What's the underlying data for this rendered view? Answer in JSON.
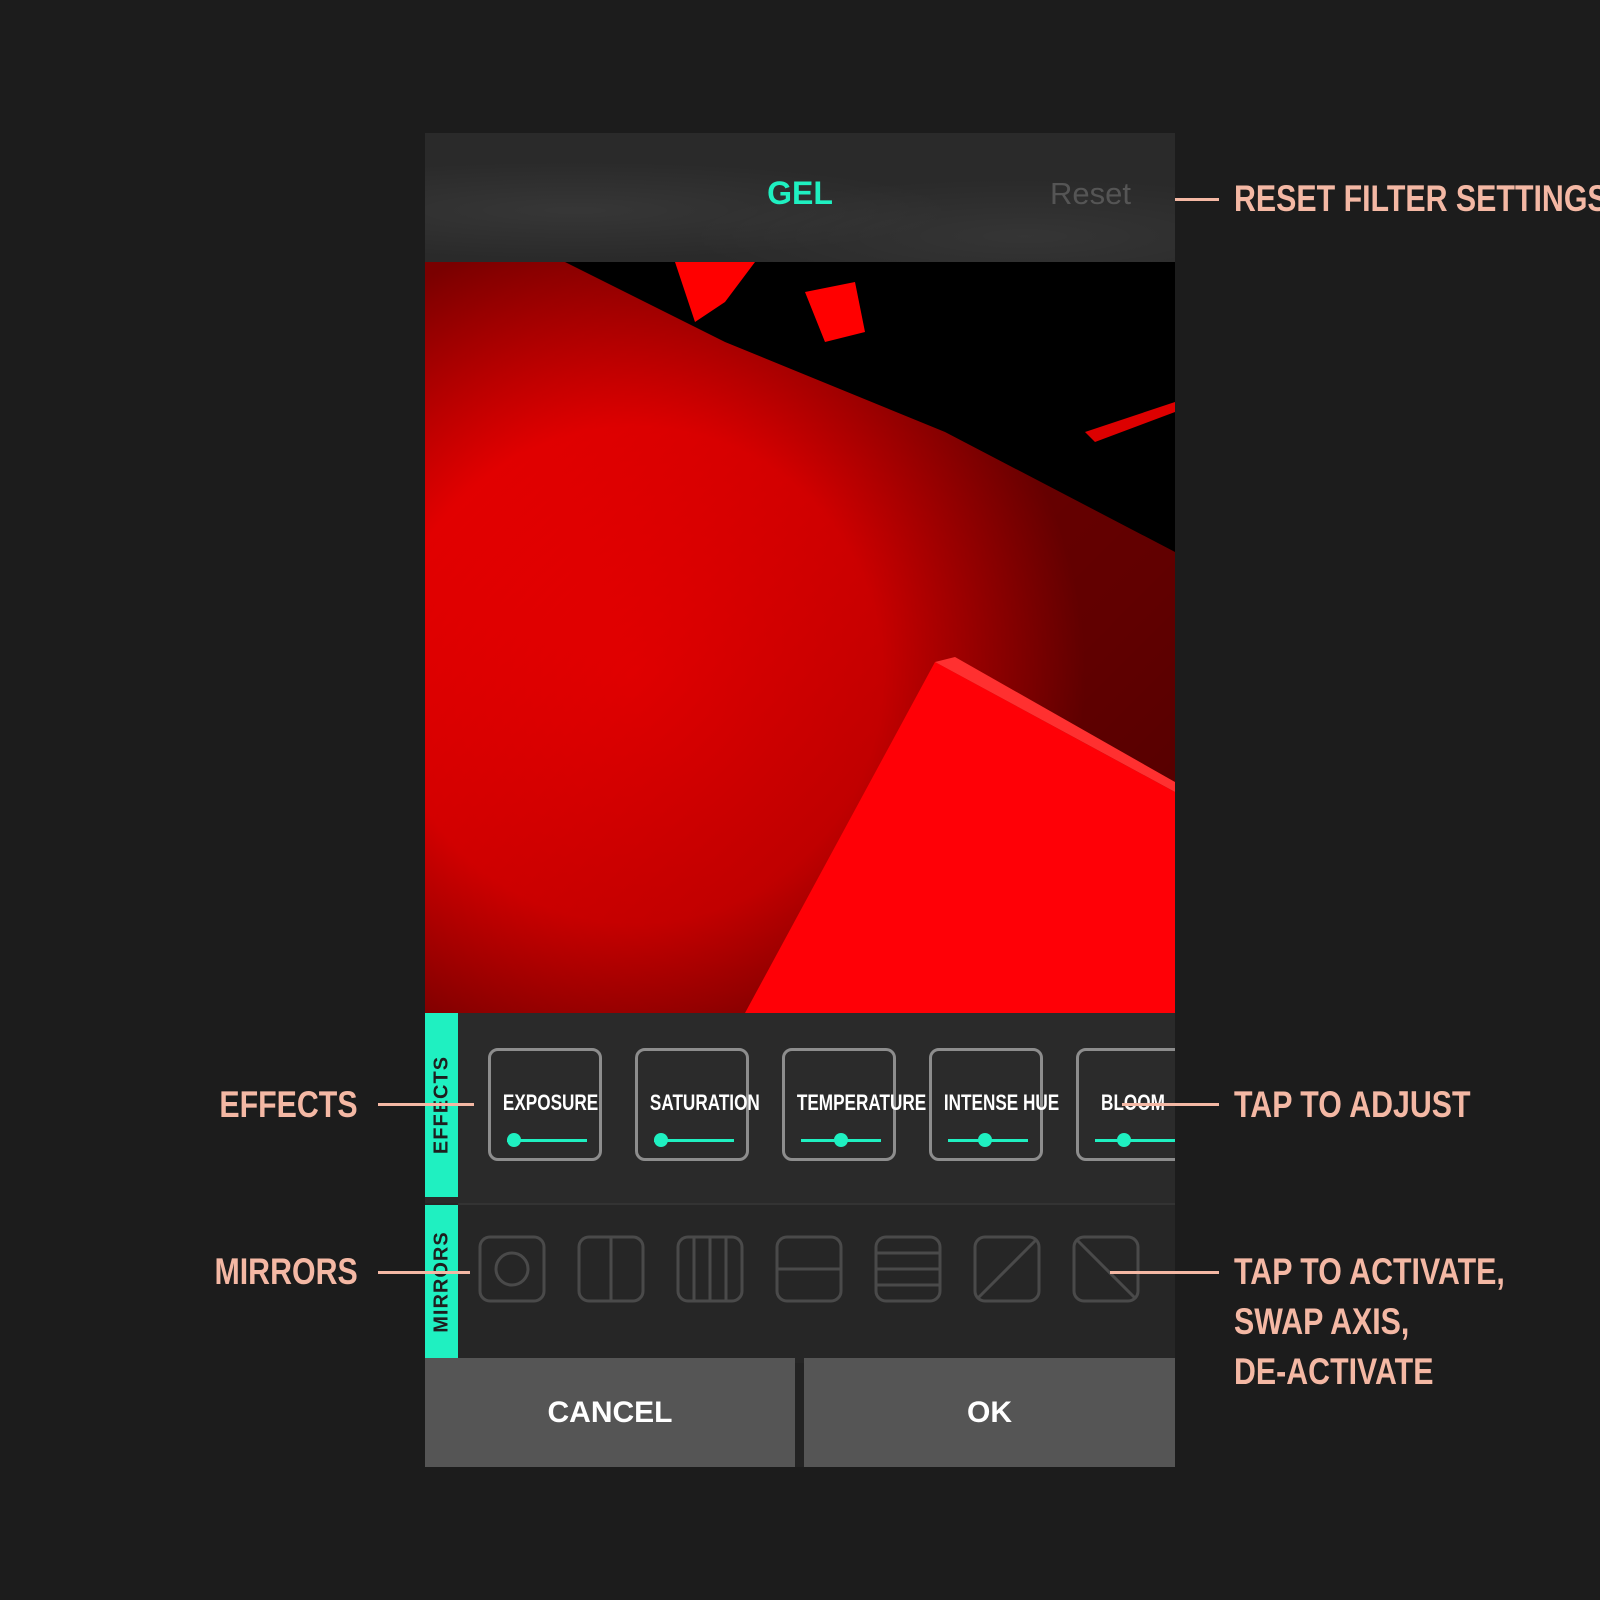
{
  "header": {
    "title": "GEL",
    "reset_label": "Reset"
  },
  "effects": {
    "tab_label": "EFFECTS",
    "items": [
      {
        "label": "EXPOSURE",
        "value": 0.0
      },
      {
        "label": "SATURATION",
        "value": 0.0
      },
      {
        "label": "TEMPERATURE",
        "value": 0.5
      },
      {
        "label": "INTENSE HUE",
        "value": 0.45
      },
      {
        "label": "BLOOM",
        "value": 0.35
      }
    ]
  },
  "mirrors": {
    "tab_label": "MIRRORS",
    "items": [
      "mirror-circle-icon",
      "mirror-vertical-split-icon",
      "mirror-quad-vertical-icon",
      "mirror-horizontal-split-icon",
      "mirror-quad-horizontal-icon",
      "mirror-diagonal-up-icon",
      "mirror-diagonal-down-icon"
    ]
  },
  "actions": {
    "cancel_label": "CANCEL",
    "ok_label": "OK"
  },
  "annotations": {
    "reset": "RESET FILTER SETTINGS",
    "effects": "EFFECTS",
    "tap_adjust": "TAP TO ADJUST",
    "mirrors": "MIRRORS",
    "tap_activate_1": "TAP TO ACTIVATE,",
    "tap_activate_2": "SWAP AXIS,",
    "tap_activate_3": "DE-ACTIVATE"
  },
  "colors": {
    "accent": "#1ff0c1",
    "annotation": "#f4b8a4",
    "photo_red": "#ff0000"
  }
}
